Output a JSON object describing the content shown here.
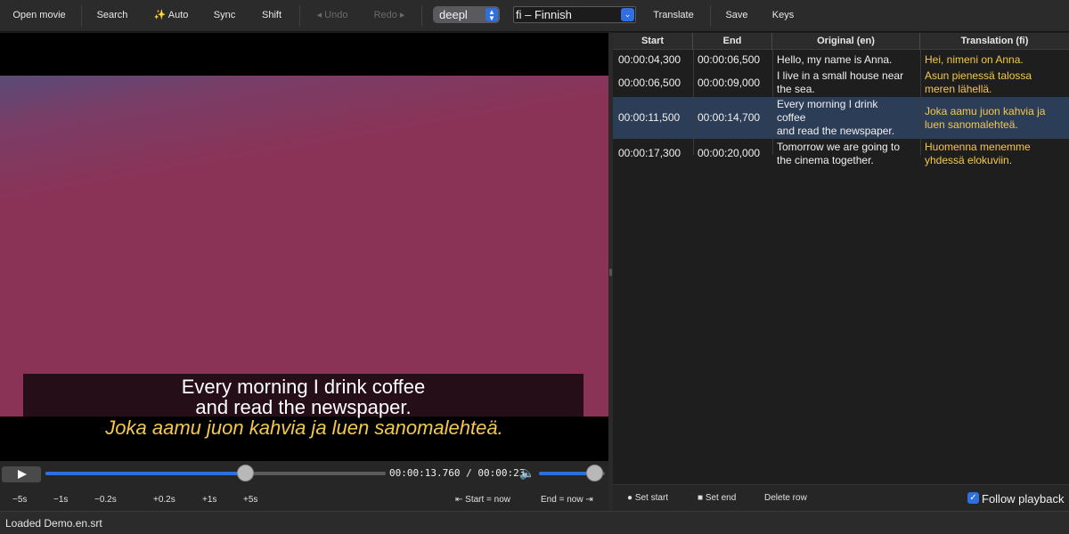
{
  "toolbar": {
    "open_movie": "Open movie",
    "search": "Search",
    "auto": "✨ Auto",
    "sync": "Sync",
    "shift": "Shift",
    "undo": "◂ Undo",
    "redo": "Redo ▸",
    "engine": "deepl",
    "target_language": "fi – Finnish",
    "translate": "Translate",
    "save": "Save",
    "keys": "Keys"
  },
  "video": {
    "subtitle_line1": "Every morning I drink coffee",
    "subtitle_line2": "and read the newspaper.",
    "subtitle_translation": "Joka aamu juon kahvia ja luen sanomalehteä."
  },
  "transport": {
    "timecode": "00:00:13.760 / 00:00:23",
    "progress": 0.59,
    "volume": 0.85,
    "nudges": [
      "−5s",
      "−1s",
      "−0.2s",
      "+0.2s",
      "+1s",
      "+5s"
    ],
    "start_now": "⇤ Start = now",
    "end_now": "End = now ⇥"
  },
  "table": {
    "headers": [
      "Start",
      "End",
      "Original (en)",
      "Translation (fi)"
    ],
    "rows": [
      {
        "start": "00:00:04,300",
        "end": "00:00:06,500",
        "orig1": "Hello, my name is Anna.",
        "orig2": "",
        "orig3": "",
        "tr1": "Hei, nimeni on Anna.",
        "tr2": ""
      },
      {
        "start": "00:00:06,500",
        "end": "00:00:09,000",
        "orig1": "I live in a small house near",
        "orig2": "the sea.",
        "orig3": "",
        "tr1": "Asun pienessä talossa",
        "tr2": "meren lähellä."
      },
      {
        "start": "00:00:11,500",
        "end": "00:00:14,700",
        "orig1": "Every morning I drink",
        "orig2": "coffee",
        "orig3": "and read the newspaper.",
        "tr1": "Joka aamu juon kahvia ja",
        "tr2": "luen sanomalehteä."
      },
      {
        "start": "00:00:17,300",
        "end": "00:00:20,000",
        "orig1": "Tomorrow we are going to",
        "orig2": "the cinema together.",
        "orig3": "",
        "tr1": "Huomenna menemme",
        "tr2": "yhdessä elokuviin."
      }
    ],
    "selected_row": 2
  },
  "table_footer": {
    "set_start": "● Set start",
    "set_end": "■ Set end",
    "delete_row": "Delete row",
    "follow_playback": "Follow playback",
    "follow_checked": true
  },
  "status": {
    "text": "Loaded Demo.en.srt"
  },
  "colors": {
    "accent": "#2f6fe0",
    "translation": "#f5c84a",
    "selection": "#2c3d58",
    "video_frame": "#8a3357"
  }
}
